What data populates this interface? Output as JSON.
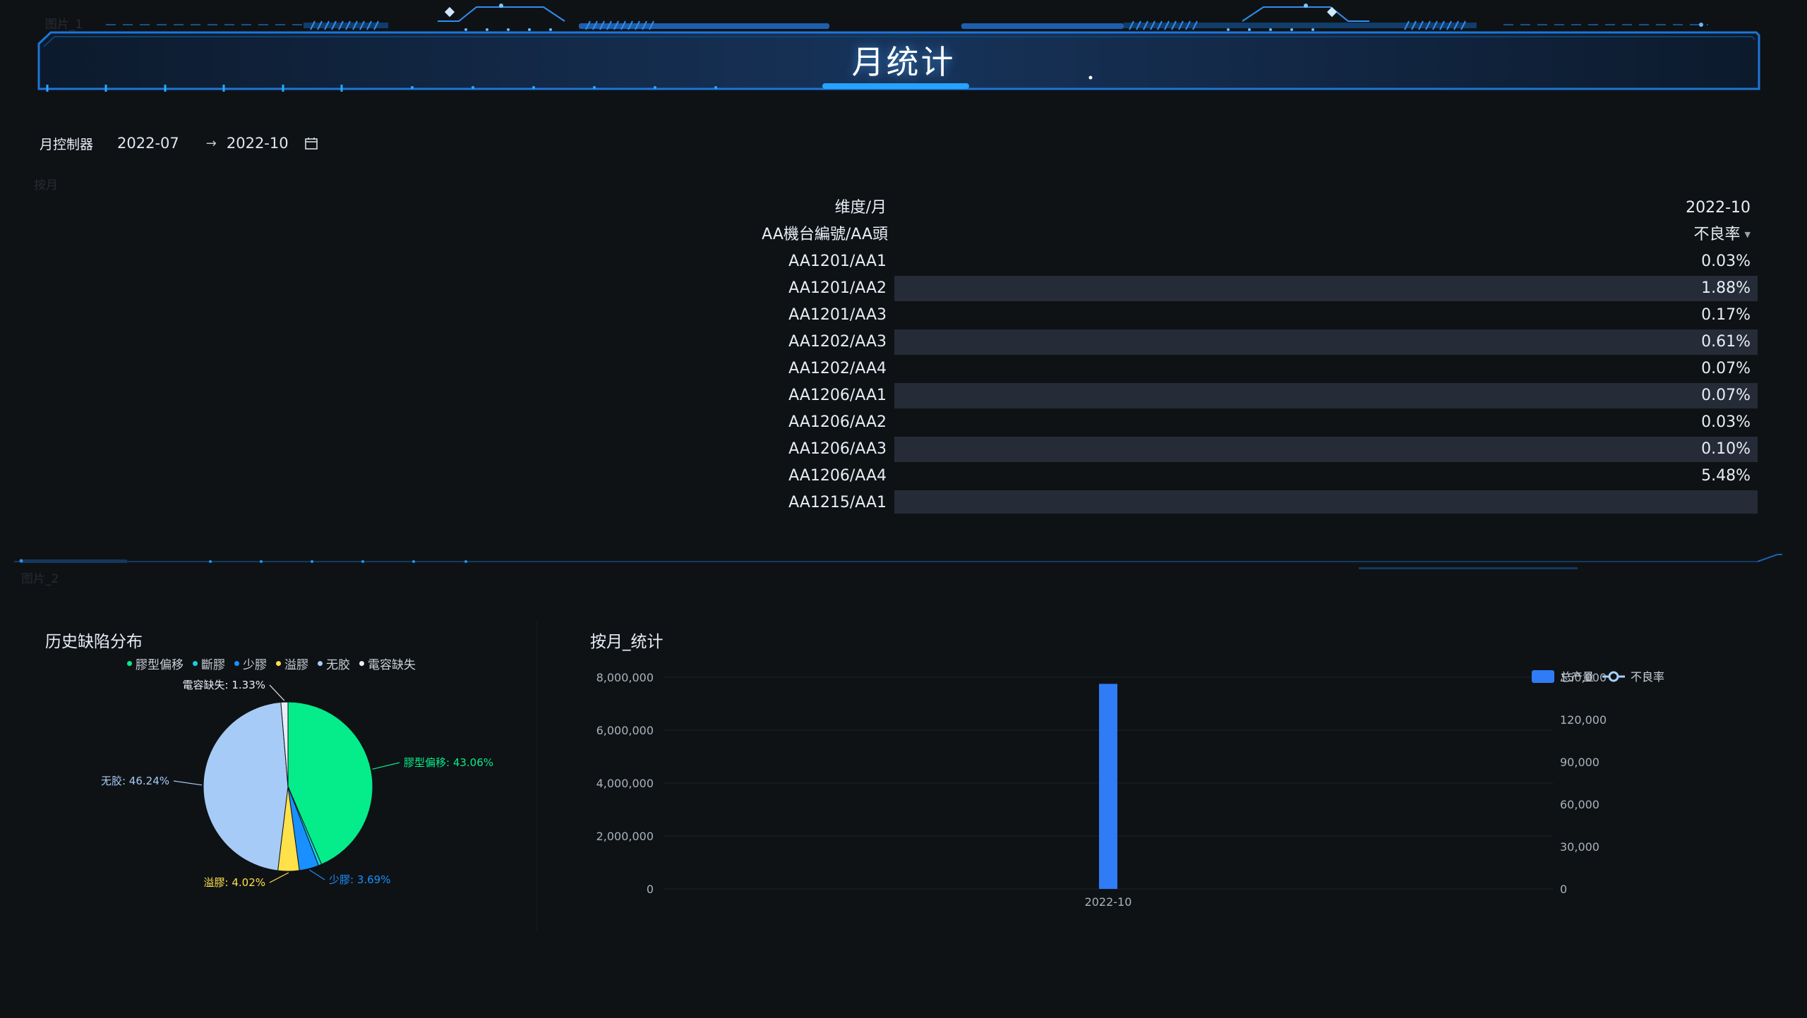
{
  "header": {
    "title": "月统计",
    "image_label_1": "图片_1",
    "image_label_2": "图片_2",
    "section_label": "按月"
  },
  "month_control": {
    "label": "月控制器",
    "start": "2022-07",
    "separator": "→",
    "end": "2022-10",
    "calendar_icon": "calendar-icon"
  },
  "pivot": {
    "row_header": "维度/月",
    "row_dim": "AA機台編號/AA頭",
    "column": "2022-10",
    "measure": "不良率",
    "rows": [
      {
        "key": "AA1201/AA1",
        "value": "0.03%"
      },
      {
        "key": "AA1201/AA2",
        "value": "1.88%"
      },
      {
        "key": "AA1201/AA3",
        "value": "0.17%"
      },
      {
        "key": "AA1202/AA3",
        "value": "0.61%"
      },
      {
        "key": "AA1202/AA4",
        "value": "0.07%"
      },
      {
        "key": "AA1206/AA1",
        "value": "0.07%"
      },
      {
        "key": "AA1206/AA2",
        "value": "0.03%"
      },
      {
        "key": "AA1206/AA3",
        "value": "0.10%"
      },
      {
        "key": "AA1206/AA4",
        "value": "5.48%"
      },
      {
        "key": "AA1215/AA1",
        "value": ""
      }
    ]
  },
  "colors": {
    "accent": "#1e8fff",
    "bar": "#2f7cf6",
    "line": "#a7d1ff",
    "stripe": "#252c38"
  },
  "charts": {
    "pie_title": "历史缺陷分布",
    "bar_title": "按月_统计"
  },
  "chart_data": [
    {
      "type": "pie",
      "title": "历史缺陷分布",
      "legend_position": "top",
      "legend": [
        "膠型偏移",
        "斷膠",
        "少膠",
        "溢膠",
        "无胶",
        "電容缺失"
      ],
      "slices": [
        {
          "name": "膠型偏移",
          "value": 43.06,
          "label": "膠型偏移: 43.06%",
          "color": "#05ec8b"
        },
        {
          "name": "斷膠",
          "value": 0.6,
          "label": "",
          "color": "#14d1e0"
        },
        {
          "name": "少膠",
          "value": 3.69,
          "label": "少膠: 3.69%",
          "color": "#1890ff"
        },
        {
          "name": "溢膠",
          "value": 4.02,
          "label": "溢膠: 4.02%",
          "color": "#ffe14a"
        },
        {
          "name": "无胶",
          "value": 46.24,
          "label": "无胶: 46.24%",
          "color": "#a7cbf7"
        },
        {
          "name": "電容缺失",
          "value": 1.33,
          "label": "電容缺失: 1.33%",
          "color": "#e8eef6"
        }
      ]
    },
    {
      "type": "bar",
      "title": "按月_统计",
      "categories": [
        "2022-10"
      ],
      "series": [
        {
          "name": "总产量",
          "type": "bar",
          "axis": "left",
          "values": [
            7750000
          ],
          "color": "#2f7cf6"
        },
        {
          "name": "不良率",
          "type": "line",
          "axis": "right",
          "values": [
            null
          ],
          "color": "#a7d1ff"
        }
      ],
      "y_left": {
        "min": 0,
        "max": 8000000,
        "ticks": [
          0,
          2000000,
          4000000,
          6000000,
          8000000
        ],
        "tick_labels": [
          "0",
          "2,000,000",
          "4,000,000",
          "6,000,000",
          "8,000,000"
        ]
      },
      "y_right": {
        "min": 0,
        "max": 150000,
        "ticks": [
          0,
          30000,
          60000,
          90000,
          120000,
          150000
        ],
        "tick_labels": [
          "0",
          "30,000",
          "60,000",
          "90,000",
          "120,000",
          "150,000"
        ]
      },
      "legend_position": "top-right",
      "grid": true
    }
  ]
}
